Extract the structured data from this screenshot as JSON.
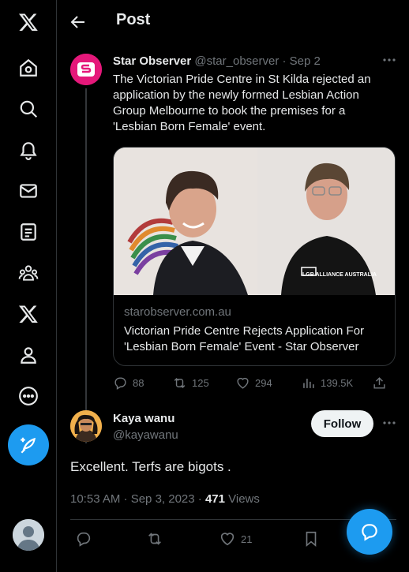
{
  "nav": {
    "items": [
      "x-logo-icon",
      "home-icon",
      "search-icon",
      "notifications-icon",
      "messages-icon",
      "lists-icon",
      "communities-icon",
      "premium-icon",
      "profile-icon",
      "more-icon"
    ],
    "compose_icon": "compose-icon"
  },
  "header": {
    "title": "Post"
  },
  "quoted": {
    "author_name": "Star Observer",
    "author_handle": "@star_observer",
    "date": "· Sep 2",
    "text": "The Victorian Pride Centre in St Kilda rejected an application by the newly formed Lesbian Action Group Melbourne to book the premises for a 'Lesbian Born Female' event.",
    "card": {
      "shirt_text": "LGB ALLIANCE AUSTRALIA",
      "domain": "starobserver.com.au",
      "title": "Victorian Pride Centre Rejects Application For 'Lesbian Born Female' Event - Star Observer"
    },
    "stats": {
      "replies": "88",
      "reposts": "125",
      "likes": "294",
      "views": "139.5K"
    }
  },
  "post": {
    "author_name": "Kaya wanu",
    "author_handle": "@kayawanu",
    "follow_label": "Follow",
    "text": "Excellent. Terfs are bigots .",
    "timestamp": "10:53 AM · Sep 3, 2023 · ",
    "views_count": "471",
    "views_label": " Views",
    "stats": {
      "likes": "21"
    }
  },
  "colors": {
    "accent": "#1d9bf0",
    "background": "#000000",
    "muted": "#71767b",
    "brand_pink": "#e5187a"
  }
}
